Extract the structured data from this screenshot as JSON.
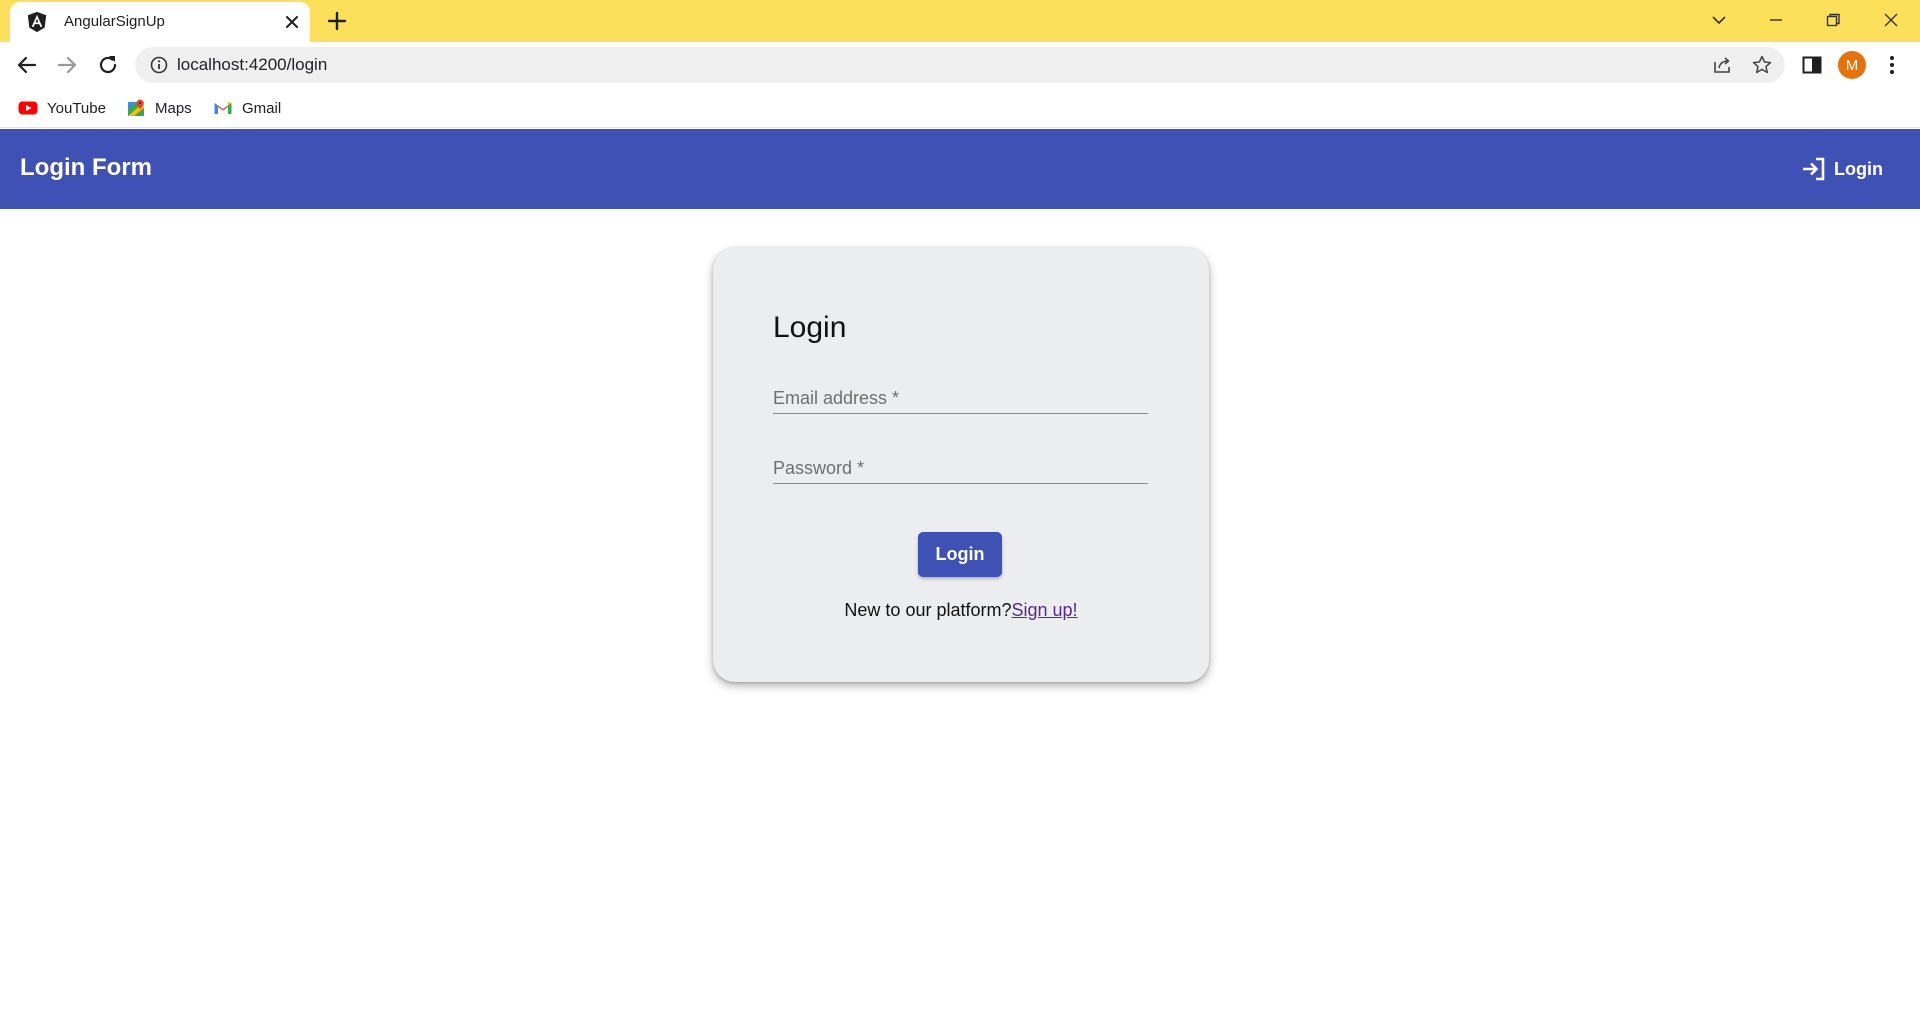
{
  "browser": {
    "tab_title": "AngularSignUp",
    "url": "localhost:4200/login",
    "avatar_initial": "M",
    "bookmarks": [
      {
        "label": "YouTube",
        "icon": "youtube-icon"
      },
      {
        "label": "Maps",
        "icon": "maps-icon"
      },
      {
        "label": "Gmail",
        "icon": "gmail-icon"
      }
    ],
    "colors": {
      "tabstrip": "#fde05a",
      "avatar": "#e8710a"
    }
  },
  "app": {
    "title": "Login Form",
    "nav_login_label": "Login",
    "colors": {
      "primary": "#3f51b5",
      "card_bg": "#ebedef",
      "link": "#5a2a86"
    }
  },
  "login_card": {
    "heading": "Login",
    "email_placeholder": "Email address *",
    "password_placeholder": "Password *",
    "submit_label": "Login",
    "signup_prompt": "New to our platform?",
    "signup_link": "Sign up!"
  }
}
